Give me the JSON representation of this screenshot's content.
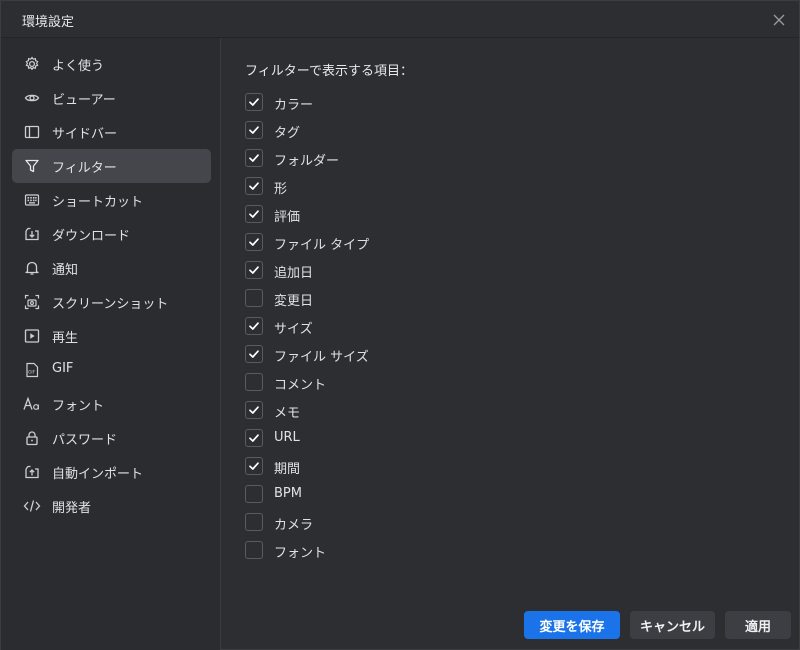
{
  "window": {
    "title": "環境設定"
  },
  "sidebar": {
    "items": [
      {
        "label": "よく使う",
        "icon": "gear-icon"
      },
      {
        "label": "ビューアー",
        "icon": "eye-icon"
      },
      {
        "label": "サイドバー",
        "icon": "sidebar-icon"
      },
      {
        "label": "フィルター",
        "icon": "filter-icon",
        "active": true
      },
      {
        "label": "ショートカット",
        "icon": "keyboard-icon"
      },
      {
        "label": "ダウンロード",
        "icon": "download-icon"
      },
      {
        "label": "通知",
        "icon": "bell-icon"
      },
      {
        "label": "スクリーンショット",
        "icon": "screenshot-icon"
      },
      {
        "label": "再生",
        "icon": "play-icon"
      },
      {
        "label": "GIF",
        "icon": "gif-icon"
      },
      {
        "label": "フォント",
        "icon": "font-icon"
      },
      {
        "label": "パスワード",
        "icon": "lock-icon"
      },
      {
        "label": "自動インポート",
        "icon": "import-icon"
      },
      {
        "label": "開発者",
        "icon": "code-icon"
      }
    ]
  },
  "main": {
    "section_title": "フィルターで表示する項目：",
    "options": [
      {
        "label": "カラー",
        "checked": true
      },
      {
        "label": "タグ",
        "checked": true
      },
      {
        "label": "フォルダー",
        "checked": true
      },
      {
        "label": "形",
        "checked": true
      },
      {
        "label": "評価",
        "checked": true
      },
      {
        "label": "ファイル タイプ",
        "checked": true
      },
      {
        "label": "追加日",
        "checked": true
      },
      {
        "label": "変更日",
        "checked": false
      },
      {
        "label": "サイズ",
        "checked": true
      },
      {
        "label": "ファイル サイズ",
        "checked": true
      },
      {
        "label": "コメント",
        "checked": false
      },
      {
        "label": "メモ",
        "checked": true
      },
      {
        "label": "URL",
        "checked": true
      },
      {
        "label": "期間",
        "checked": true
      },
      {
        "label": "BPM",
        "checked": false
      },
      {
        "label": "カメラ",
        "checked": false
      },
      {
        "label": "フォント",
        "checked": false
      }
    ]
  },
  "footer": {
    "save_label": "変更を保存",
    "cancel_label": "キャンセル",
    "apply_label": "適用"
  },
  "colors": {
    "accent": "#1a73e8",
    "active_item": "#45464b",
    "background": "#2d2e31"
  }
}
